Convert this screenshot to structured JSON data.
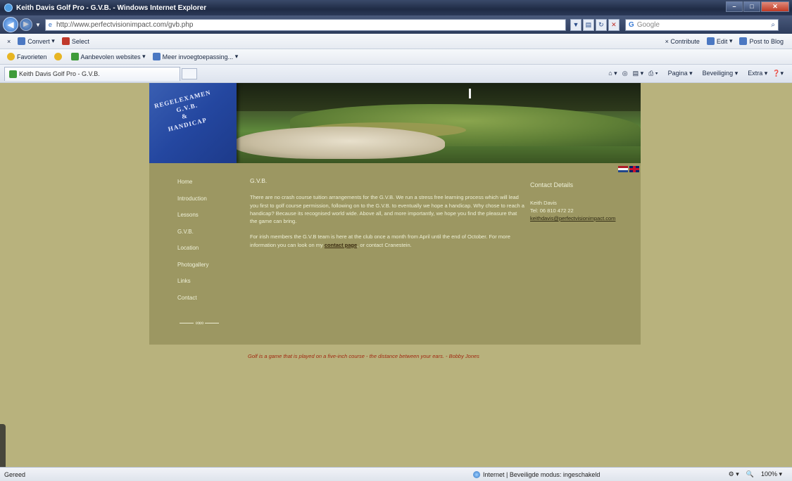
{
  "window": {
    "title": "Keith Davis Golf Pro - G.V.B. - Windows Internet Explorer",
    "controls": [
      "–",
      "□",
      "✕"
    ]
  },
  "address": {
    "url": "http://www.perfectvisionimpact.com/gvb.php",
    "search_placeholder": "Google"
  },
  "toolbar1": {
    "convert": "Convert",
    "select": "Select",
    "contribute": "Contribute",
    "edit": "Edit",
    "post_to_blog": "Post to Blog"
  },
  "toolbar2": {
    "favorites": "Favorieten",
    "suggested_sites": "Aanbevolen websites",
    "more_addons": "Meer invoegtoepassing..."
  },
  "tabs": {
    "active_tab": "Keith Davis Golf Pro - G.V.B."
  },
  "commandbar": {
    "page": "Pagina",
    "security": "Beveiliging",
    "extra": "Extra"
  },
  "header": {
    "book_lines": [
      "REGELEXAMEN",
      "G.V.B.",
      "&",
      "HANDICAP"
    ]
  },
  "nav": {
    "items": [
      "Home",
      "Introduction",
      "Lessons",
      "G.V.B.",
      "Location",
      "Photogallery",
      "Links",
      "Contact"
    ]
  },
  "main": {
    "title": "G.V.B.",
    "p1": "There are no crash course tuition arrangements for the G.V.B. We run a stress free learning process which will lead you first to golf course permission, following on to the G.V.B. to eventually we hope a handicap. Why chose to reach a handicap? Because its recognised world wide. Above all, and more importantly, we hope you find the pleasure that the game can bring.",
    "p2_before": "For irish members the G.V.B team is here at the club once a month from April until the end of October. For more information you can look on my ",
    "p2_link": "contact page",
    "p2_after": ", or contact Cranestein."
  },
  "sidebar": {
    "title": "Contact Details",
    "name": "Keith Davis",
    "phone": "Tel: 06 810 472 22",
    "email": "keithdavis@perfectvisionimpact.com"
  },
  "footer_quote": "Golf is a game that is played on a five-inch course - the distance between your ears. - Bobby Jones",
  "status": {
    "left": "Gereed",
    "zone": "Internet | Beveiligde modus: ingeschakeld",
    "zoom": "100%"
  }
}
